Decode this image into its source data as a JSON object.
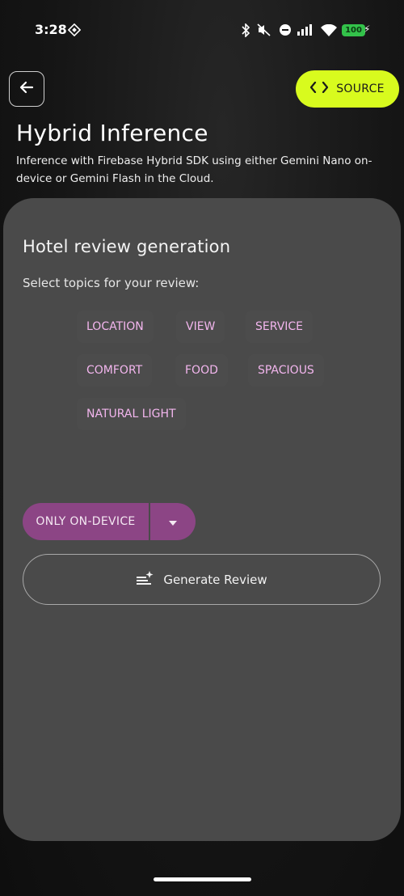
{
  "status_bar": {
    "time": "3:28",
    "battery": "100"
  },
  "header": {
    "source_label": "SOURCE",
    "title": "Hybrid Inference",
    "subtitle": "Inference with Firebase Hybrid SDK using either Gemini Nano on-device or Gemini Flash in the Cloud."
  },
  "card": {
    "title": "Hotel review generation",
    "prompt": "Select topics for your review:",
    "topics": [
      "LOCATION",
      "VIEW",
      "SERVICE",
      "COMFORT",
      "FOOD",
      "SPACIOUS",
      "NATURAL LIGHT"
    ],
    "mode_label": "ONLY ON-DEVICE",
    "generate_label": "Generate Review"
  },
  "colors": {
    "accent": "#d8fb1e",
    "chip_text": "#f3b6ee",
    "mode_button": "#8c4585",
    "card_bg": "#4a4a4a"
  },
  "icons": {
    "back": "arrow-left-icon",
    "source": "code-brackets-icon",
    "mode_toggle": "caret-down-icon",
    "generate": "sparkle-list-icon"
  }
}
